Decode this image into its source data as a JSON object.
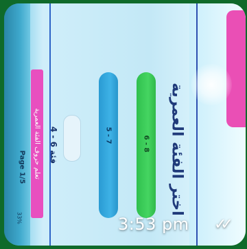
{
  "app": {
    "heading": "اختر الفئة العمرية",
    "options": [
      {
        "label": "6 - 8",
        "color": "#45d561"
      },
      {
        "label": "5 - 7",
        "color": "#3eb2e6"
      }
    ],
    "oval_button_label": "",
    "selected_category": "فئة 6 - 4",
    "instruction_tag": "تعلم حروف الفئة العمرية",
    "page_indicator": "Page 1/5",
    "percent": "33%"
  },
  "message_overlay": {
    "time": "3:53 pm",
    "read_status_icon": "double-check-icon"
  },
  "colors": {
    "frame_background": "#0f6a2a",
    "pink_accent": "#ea4fb5",
    "green_option": "#45d561",
    "blue_option": "#3eb2e6",
    "heading_color": "#1f3a7a"
  }
}
